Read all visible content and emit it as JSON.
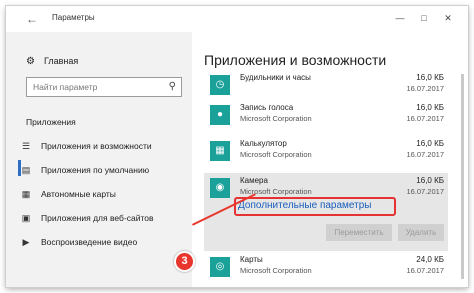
{
  "window": {
    "title": "Параметры"
  },
  "sidebar": {
    "home_label": "Главная",
    "search_placeholder": "Найти параметр",
    "section_label": "Приложения",
    "items": [
      {
        "label": "Приложения и возможности",
        "icon": "list-icon",
        "active": true
      },
      {
        "label": "Приложения по умолчанию",
        "icon": "default-apps-icon"
      },
      {
        "label": "Автономные карты",
        "icon": "map-icon"
      },
      {
        "label": "Приложения для веб-сайтов",
        "icon": "web-apps-icon"
      },
      {
        "label": "Воспроизведение видео",
        "icon": "video-icon"
      }
    ]
  },
  "main": {
    "title": "Приложения и возможности",
    "apps": [
      {
        "name": "Будильники и часы",
        "publisher": "Microsoft Corporation",
        "size": "16,0 КБ",
        "date": "16.07.2017",
        "icon": "clock-icon"
      },
      {
        "name": "Запись голоса",
        "publisher": "Microsoft Corporation",
        "size": "16,0 КБ",
        "date": "16.07.2017",
        "icon": "microphone-icon"
      },
      {
        "name": "Калькулятор",
        "publisher": "Microsoft Corporation",
        "size": "16,0 КБ",
        "date": "16.07.2017",
        "icon": "calculator-icon"
      },
      {
        "name": "Камера",
        "publisher": "Microsoft Corporation",
        "size": "16,0 КБ",
        "date": "16.07.2017",
        "icon": "camera-icon"
      },
      {
        "name": "Карты",
        "publisher": "Microsoft Corporation",
        "size": "24,0 КБ",
        "date": "16.07.2017",
        "icon": "maps-icon"
      }
    ],
    "advanced_link": "Дополнительные параметры",
    "move_button": "Переместить",
    "delete_button": "Удалить"
  },
  "annotation": {
    "step_number": "3",
    "color": "#e8362c"
  },
  "colors": {
    "accent": "#2f6fc2",
    "tile": "#1aa19a",
    "link": "#1a5fbd"
  }
}
